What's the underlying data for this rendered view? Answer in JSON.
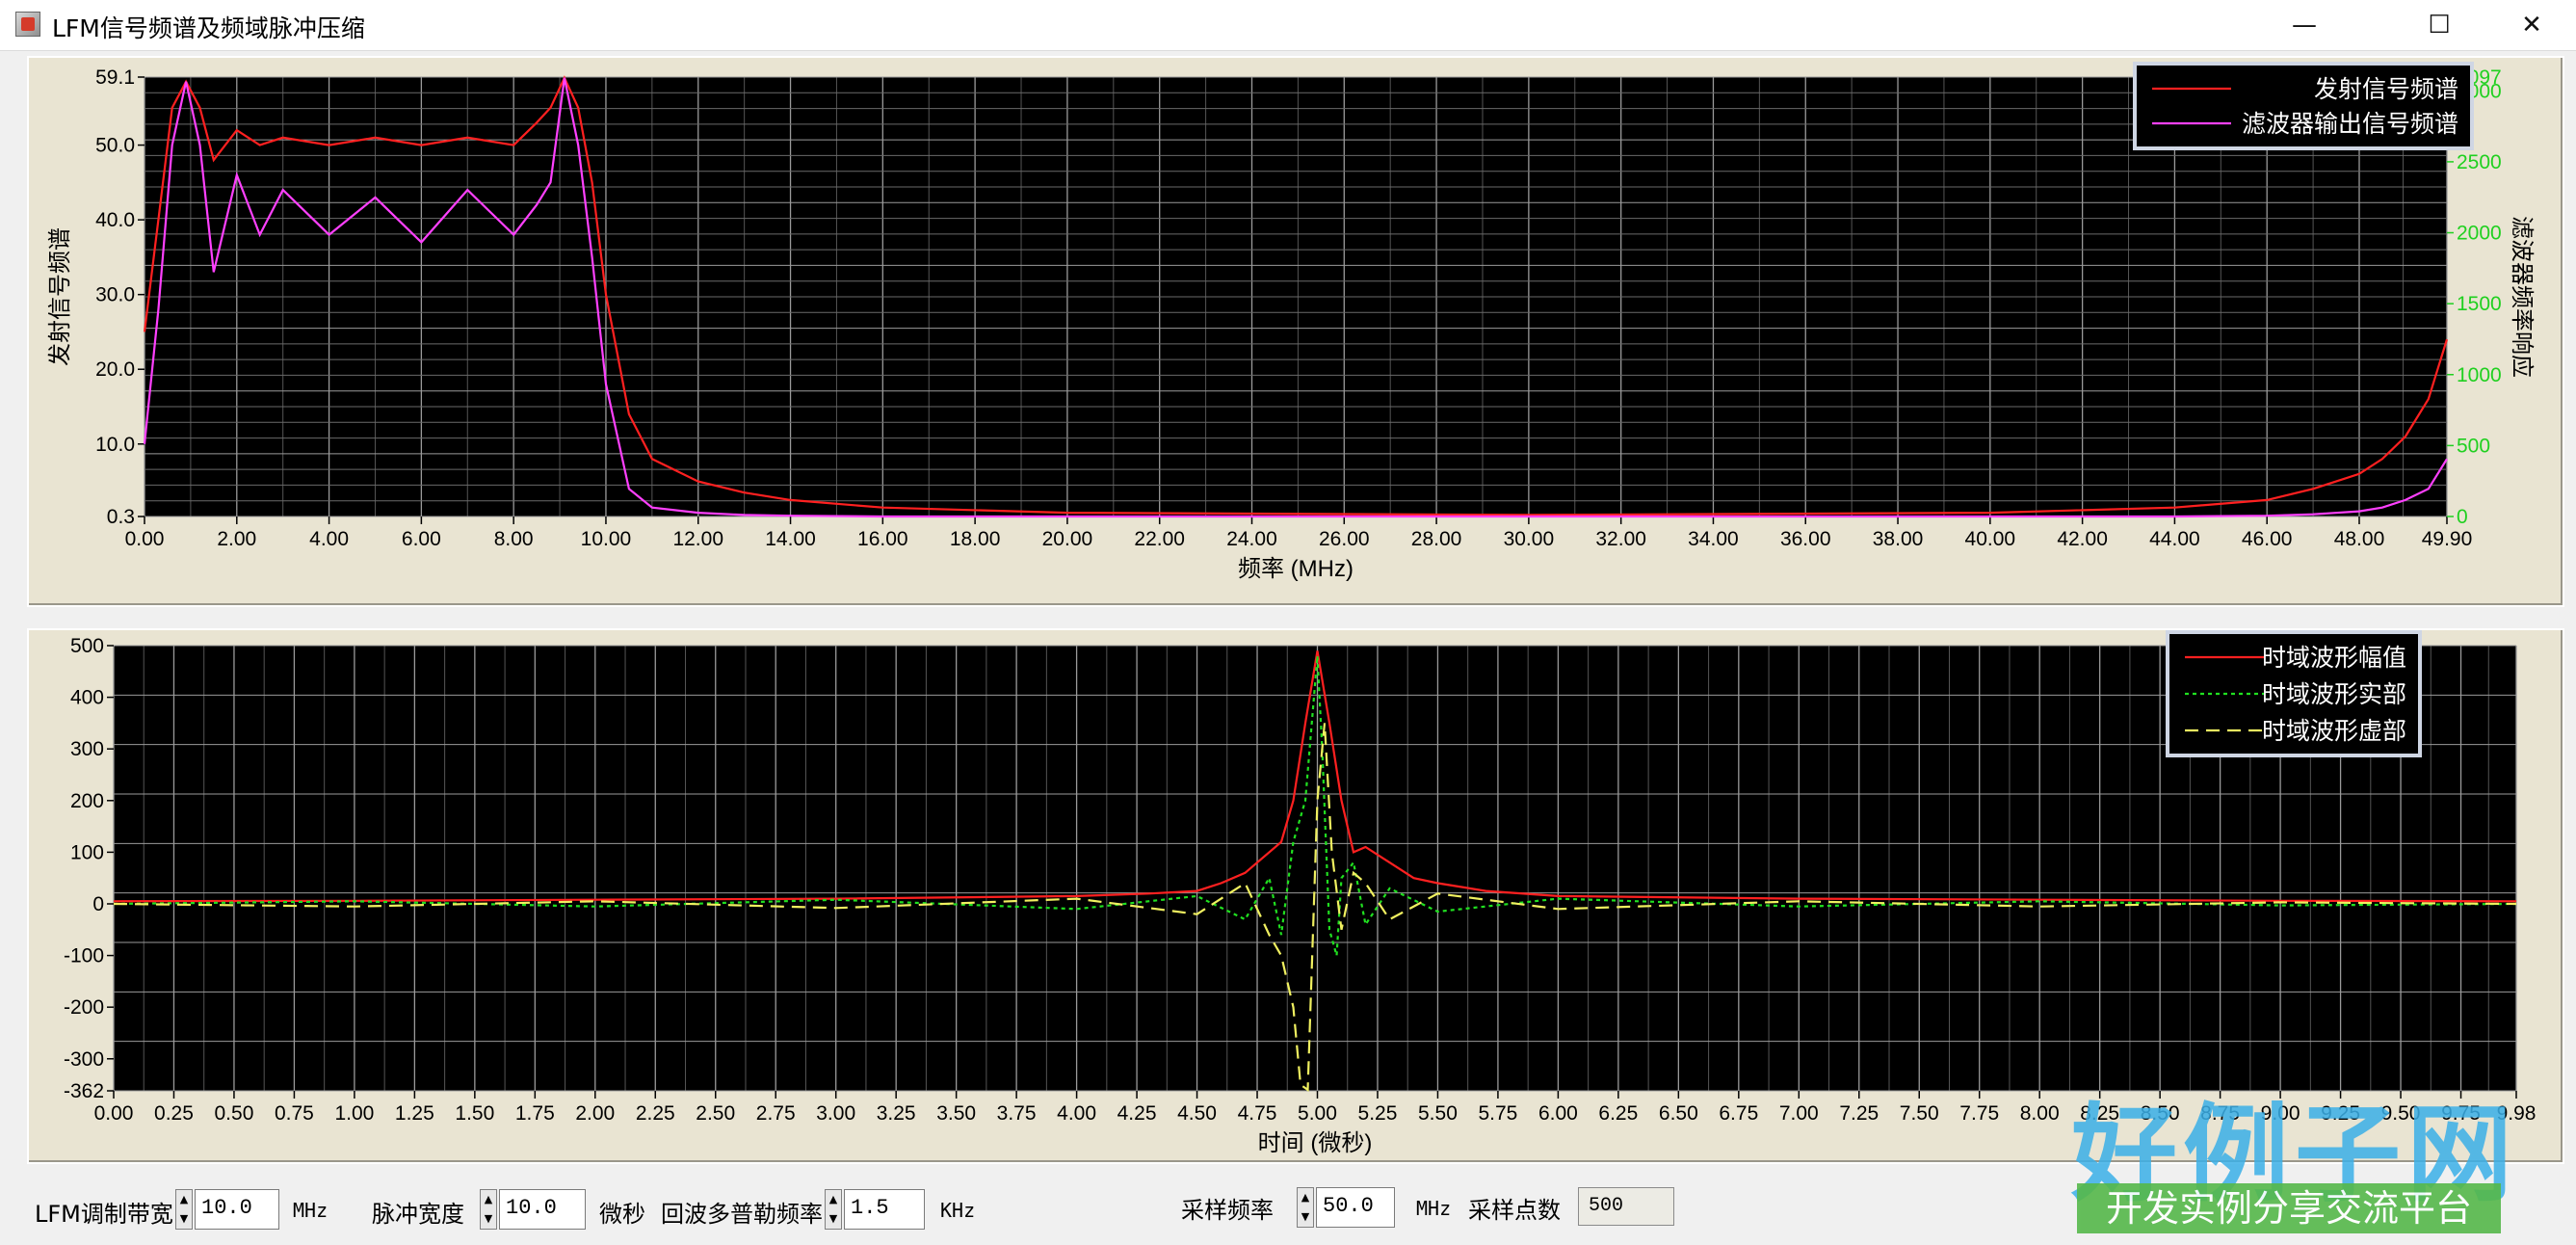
{
  "window": {
    "title": "LFM信号频谱及频域脉冲压缩",
    "minimize_glyph": "—",
    "maximize_glyph": "☐",
    "close_glyph": "✕"
  },
  "colors": {
    "plot_bg": "#000000",
    "panel_bg": "#e9e4d2",
    "grid": "#9a9a9a",
    "transmit": "#ff2020",
    "filter_out": "#ff40ff",
    "tw_amp": "#ff2020",
    "tw_real": "#20e020",
    "tw_imag": "#f0f060",
    "right_axis": "#20d020"
  },
  "spectrum_chart": {
    "left_axis_label": "发射信号频谱",
    "right_axis_label": "滤波器频率响应",
    "x_axis_label": "频率 (MHz)",
    "legend": [
      "发射信号频谱",
      "滤波器输出信号频谱"
    ]
  },
  "time_chart": {
    "x_axis_label": "时间 (微秒)",
    "legend": [
      "时域波形幅值",
      "时域波形实部",
      "时域波形虚部"
    ]
  },
  "chart_data": [
    {
      "type": "line",
      "title": "",
      "xlabel": "频率 (MHz)",
      "ylabel": "发射信号频谱",
      "y2label": "滤波器频率响应",
      "xlim": [
        0,
        49.9
      ],
      "ylim": [
        0.3,
        59.1
      ],
      "y2lim": [
        0,
        3097
      ],
      "x_ticks": [
        "0.00",
        "2.00",
        "4.00",
        "6.00",
        "8.00",
        "10.00",
        "12.00",
        "14.00",
        "16.00",
        "18.00",
        "20.00",
        "22.00",
        "24.00",
        "26.00",
        "28.00",
        "30.00",
        "32.00",
        "34.00",
        "36.00",
        "38.00",
        "40.00",
        "42.00",
        "44.00",
        "46.00",
        "48.00",
        "49.90"
      ],
      "y_ticks": [
        "0.3",
        "10.0",
        "20.0",
        "30.0",
        "40.0",
        "50.0",
        "59.1"
      ],
      "y_tick_values": [
        0.3,
        10,
        20,
        30,
        40,
        50,
        59.1
      ],
      "y2_ticks": [
        "0",
        "500",
        "1000",
        "1500",
        "2000",
        "2500",
        "3000",
        "3097"
      ],
      "y2_tick_values": [
        0,
        500,
        1000,
        1500,
        2000,
        2500,
        3000,
        3097
      ],
      "grid": true,
      "legend_position": "top-right",
      "series": [
        {
          "name": "发射信号频谱",
          "x": [
            0,
            0.3,
            0.6,
            0.9,
            1.2,
            1.5,
            2,
            2.5,
            3,
            4,
            5,
            6,
            7,
            8,
            8.5,
            8.8,
            9.1,
            9.4,
            9.7,
            10,
            10.5,
            11,
            12,
            13,
            14,
            16,
            20,
            30,
            40,
            44,
            46,
            47,
            48,
            48.5,
            49,
            49.5,
            49.9
          ],
          "y": [
            25,
            40,
            55,
            58.5,
            55,
            48,
            52,
            50,
            51,
            50,
            51,
            50,
            51,
            50,
            53,
            55,
            59,
            55,
            45,
            30,
            14,
            8,
            5,
            3.5,
            2.5,
            1.5,
            0.8,
            0.5,
            0.8,
            1.5,
            2.5,
            4,
            6,
            8,
            11,
            16,
            24
          ]
        },
        {
          "name": "滤波器输出信号频谱",
          "x": [
            0,
            0.3,
            0.6,
            0.9,
            1.2,
            1.5,
            2,
            2.5,
            3,
            4,
            5,
            6,
            7,
            8,
            8.5,
            8.8,
            9.1,
            9.4,
            9.7,
            10,
            10.5,
            11,
            12,
            13,
            14,
            16,
            20,
            30,
            40,
            44,
            46,
            47,
            48,
            48.5,
            49,
            49.5,
            49.9
          ],
          "y": [
            10,
            28,
            50,
            58.5,
            50,
            33,
            46,
            38,
            44,
            38,
            43,
            37,
            44,
            38,
            42,
            45,
            59,
            50,
            35,
            18,
            4,
            1.5,
            0.8,
            0.5,
            0.4,
            0.3,
            0.3,
            0.3,
            0.3,
            0.3,
            0.4,
            0.6,
            1,
            1.5,
            2.5,
            4,
            8
          ]
        }
      ]
    },
    {
      "type": "line",
      "title": "",
      "xlabel": "时间 (微秒)",
      "ylabel": "",
      "xlim": [
        0,
        9.98
      ],
      "ylim": [
        -362,
        500
      ],
      "x_ticks": [
        "0.00",
        "0.25",
        "0.50",
        "0.75",
        "1.00",
        "1.25",
        "1.50",
        "1.75",
        "2.00",
        "2.25",
        "2.50",
        "2.75",
        "3.00",
        "3.25",
        "3.50",
        "3.75",
        "4.00",
        "4.25",
        "4.50",
        "4.75",
        "5.00",
        "5.25",
        "5.50",
        "5.75",
        "6.00",
        "6.25",
        "6.50",
        "6.75",
        "7.00",
        "7.25",
        "7.50",
        "7.75",
        "8.00",
        "8.25",
        "8.50",
        "8.75",
        "9.00",
        "9.25",
        "9.50",
        "9.75",
        "9.98"
      ],
      "y_ticks": [
        "500",
        "400",
        "300",
        "200",
        "100",
        "0",
        "-100",
        "-200",
        "-300",
        "-362"
      ],
      "y_tick_values": [
        500,
        400,
        300,
        200,
        100,
        0,
        -100,
        -200,
        -300,
        -362
      ],
      "grid": true,
      "legend_position": "top-right",
      "series": [
        {
          "name": "时域波形幅值",
          "x": [
            0,
            1,
            2,
            3,
            4,
            4.3,
            4.5,
            4.6,
            4.7,
            4.8,
            4.85,
            4.9,
            4.95,
            5.0,
            5.05,
            5.1,
            5.15,
            5.2,
            5.3,
            5.4,
            5.5,
            5.7,
            6,
            7,
            8,
            9,
            9.98
          ],
          "y": [
            5,
            6,
            8,
            10,
            15,
            20,
            25,
            40,
            60,
            100,
            120,
            200,
            350,
            490,
            350,
            200,
            100,
            110,
            80,
            50,
            40,
            25,
            15,
            10,
            8,
            6,
            5
          ]
        },
        {
          "name": "时域波形实部",
          "x": [
            0,
            1,
            2,
            3,
            4,
            4.5,
            4.7,
            4.8,
            4.85,
            4.9,
            4.95,
            5.0,
            5.02,
            5.05,
            5.08,
            5.1,
            5.15,
            5.2,
            5.3,
            5.5,
            6,
            7,
            8,
            9,
            9.98
          ],
          "y": [
            0,
            5,
            -5,
            8,
            -10,
            15,
            -30,
            50,
            -60,
            120,
            200,
            480,
            300,
            -50,
            -100,
            50,
            80,
            -40,
            30,
            -15,
            10,
            -5,
            5,
            -3,
            0
          ]
        },
        {
          "name": "时域波形虚部",
          "x": [
            0,
            1,
            2,
            3,
            4,
            4.5,
            4.7,
            4.8,
            4.85,
            4.9,
            4.93,
            4.96,
            5.0,
            5.03,
            5.06,
            5.1,
            5.15,
            5.2,
            5.3,
            5.5,
            6,
            7,
            8,
            9,
            9.98
          ],
          "y": [
            0,
            -5,
            5,
            -8,
            10,
            -20,
            40,
            -60,
            -100,
            -200,
            -350,
            -360,
            200,
            350,
            100,
            -50,
            60,
            40,
            -30,
            20,
            -10,
            5,
            -5,
            3,
            0
          ]
        }
      ]
    }
  ],
  "controls": {
    "lfm_bw_label": "LFM调制带宽",
    "lfm_bw_value": "10.0",
    "lfm_bw_unit": "MHz",
    "pulse_width_label": "脉冲宽度",
    "pulse_width_value": "10.0",
    "pulse_width_unit": "微秒",
    "doppler_label": "回波多普勒频率",
    "doppler_value": "1.5",
    "doppler_unit": "KHz",
    "fs_label": "采样频率",
    "fs_value": "50.0",
    "fs_unit": "MHz",
    "npoints_label": "采样点数",
    "npoints_value": "500"
  },
  "watermark": {
    "big_text": "好例子网",
    "band_text": "开发实例分享交流平台"
  }
}
